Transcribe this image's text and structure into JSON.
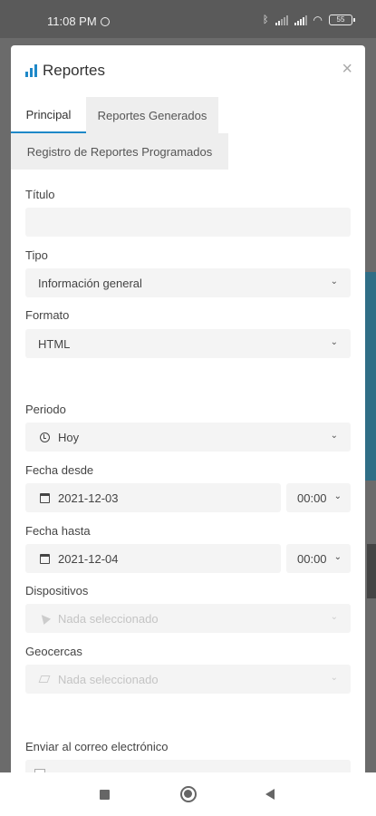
{
  "status_bar": {
    "time": "11:08 PM",
    "battery": "55"
  },
  "modal": {
    "title": "Reportes",
    "tabs": [
      {
        "label": "Principal",
        "active": true
      },
      {
        "label": "Reportes Generados",
        "active": false
      },
      {
        "label": "Registro de Reportes Programados",
        "active": false
      }
    ]
  },
  "form": {
    "titulo": {
      "label": "Título",
      "value": ""
    },
    "tipo": {
      "label": "Tipo",
      "value": "Información general"
    },
    "formato": {
      "label": "Formato",
      "value": "HTML"
    },
    "periodo": {
      "label": "Periodo",
      "value": "Hoy",
      "icon": "clock-icon"
    },
    "fecha_desde": {
      "label": "Fecha desde",
      "date": "2021-12-03",
      "time": "00:00",
      "icon": "calendar-icon"
    },
    "fecha_hasta": {
      "label": "Fecha hasta",
      "date": "2021-12-04",
      "time": "00:00",
      "icon": "calendar-icon"
    },
    "dispositivos": {
      "label": "Dispositivos",
      "placeholder": "Nada seleccionado",
      "icon": "navigation-arrow-icon"
    },
    "geocercas": {
      "label": "Geocercas",
      "placeholder": "Nada seleccionado",
      "icon": "polygon-icon"
    },
    "email": {
      "label": "Enviar al correo electrónico"
    }
  },
  "colors": {
    "accent": "#1e88c8",
    "field_bg": "#f4f4f4",
    "tab_bg": "#eeeeee"
  }
}
